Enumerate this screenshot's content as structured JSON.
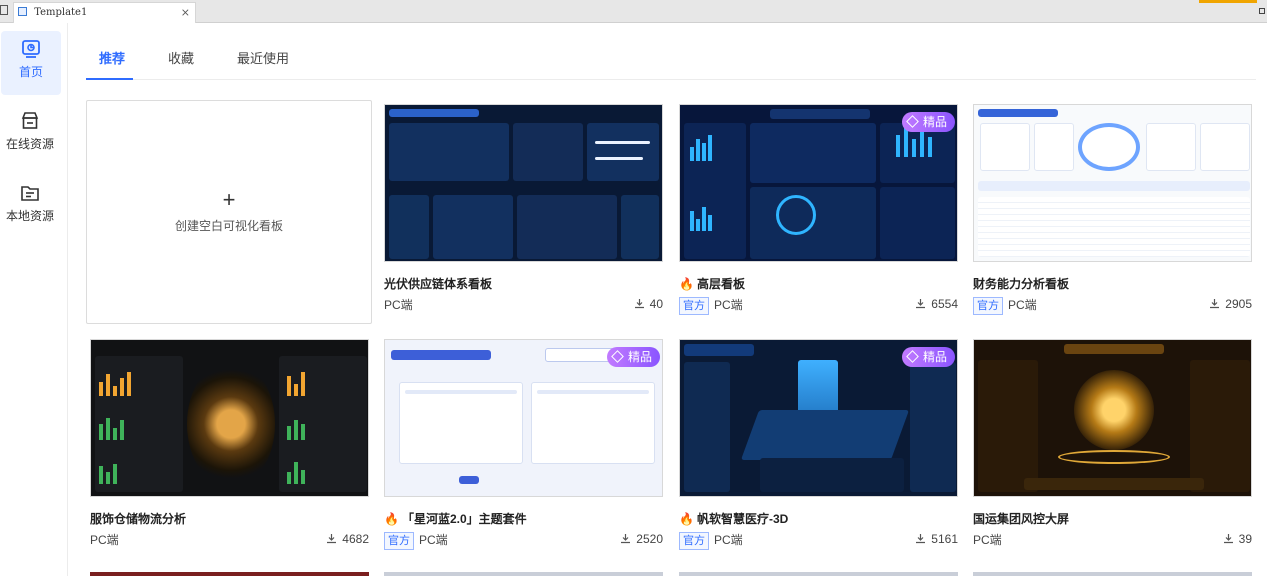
{
  "window": {
    "tab_title": "Template1",
    "tab_close": "×"
  },
  "sidebar": {
    "items": [
      {
        "label": "首页",
        "icon": "dashboard-icon"
      },
      {
        "label": "在线资源",
        "icon": "store-icon"
      },
      {
        "label": "本地资源",
        "icon": "folder-icon"
      }
    ]
  },
  "tabs": [
    {
      "label": "推荐"
    },
    {
      "label": "收藏"
    },
    {
      "label": "最近使用"
    }
  ],
  "create_card": {
    "plus": "+",
    "label": "创建空白可视化看板"
  },
  "cards": [
    {
      "title": "光伏供应链体系看板",
      "platform": "PC端",
      "official": "",
      "downloads": "40",
      "premium": ""
    },
    {
      "title": "高层看板",
      "platform": "PC端",
      "official": "官方",
      "downloads": "6554",
      "premium": "精品",
      "hot": true
    },
    {
      "title": "财务能力分析看板",
      "platform": "PC端",
      "official": "官方",
      "downloads": "2905",
      "premium": ""
    },
    {
      "title": "服饰仓储物流分析",
      "platform": "PC端",
      "official": "",
      "downloads": "4682",
      "premium": ""
    },
    {
      "title": "「星河蓝2.0」主题套件",
      "platform": "PC端",
      "official": "官方",
      "downloads": "2520",
      "premium": "精品",
      "hot": true
    },
    {
      "title": "帆软智慧医疗-3D",
      "platform": "PC端",
      "official": "官方",
      "downloads": "5161",
      "premium": "精品",
      "hot": true
    },
    {
      "title": "国运集团风控大屏",
      "platform": "PC端",
      "official": "",
      "downloads": "39",
      "premium": ""
    }
  ],
  "thumb_text": {
    "c2_header": "高层管理看板",
    "c3_header": "财务能力分析看板",
    "c3_tab": "指标分析",
    "c4_header": "服饰仓储物流分析",
    "c5_header": "布局+ 配套指标卡 快速搭建",
    "c5_count": "6",
    "c6_header": "帆软智慧医疗",
    "c7_header": "国运集团风控大屏"
  },
  "colors": {
    "accent": "#2f6cff",
    "hot": "#ff5a1f",
    "premium": "#9b63ff"
  }
}
